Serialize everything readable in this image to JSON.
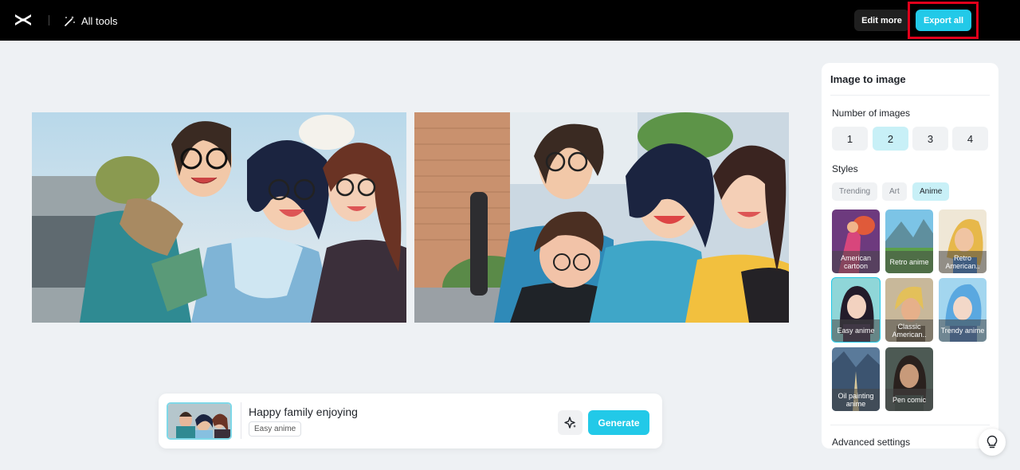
{
  "topbar": {
    "logo_icon": "capcut-logo-icon",
    "all_tools_label": "All tools",
    "edit_more_label": "Edit more",
    "export_all_label": "Export all"
  },
  "prompt": {
    "text": "Happy family enjoying",
    "style_tag": "Easy anime",
    "generate_label": "Generate",
    "magic_icon": "sparkle-icon"
  },
  "panel": {
    "title": "Image to image",
    "number_label": "Number of images",
    "numbers": [
      "1",
      "2",
      "3",
      "4"
    ],
    "selected_number": "2",
    "styles_label": "Styles",
    "style_filters": [
      "Trending",
      "Art",
      "Anime"
    ],
    "selected_filter": "Anime",
    "styles": [
      "American cartoon",
      "Retro anime",
      "Retro American..",
      "Easy anime",
      "Classic American..",
      "Trendy anime",
      "Oil painting anime",
      "Pen comic"
    ],
    "selected_style": "Easy anime",
    "advanced_label": "Advanced settings"
  },
  "colors": {
    "accent": "#22c9e8",
    "selected_bg": "#c8f0f7",
    "highlight_box": "#e0001b"
  }
}
